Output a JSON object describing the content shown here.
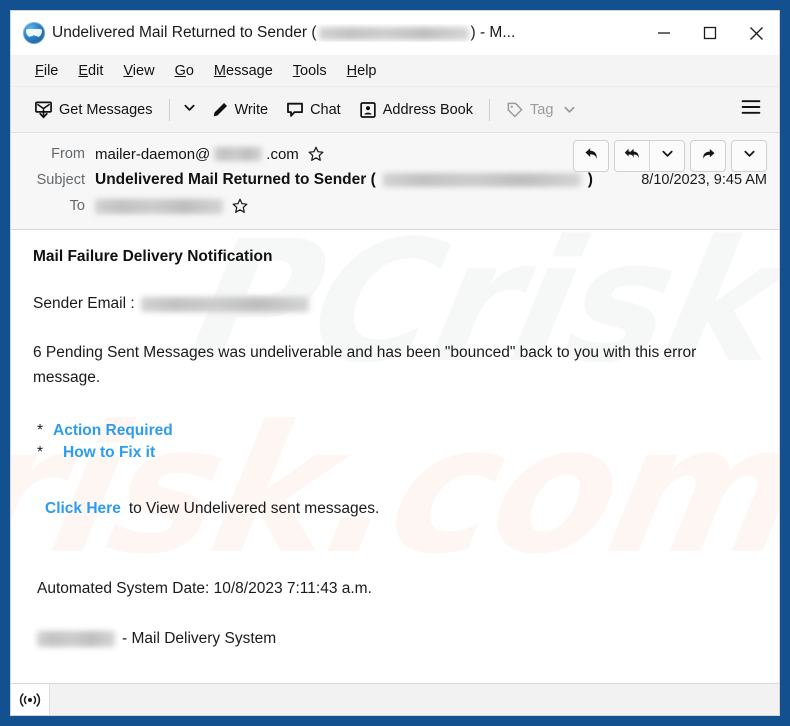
{
  "window": {
    "title_prefix": "Undelivered Mail Returned to Sender (",
    "title_suffix": ") - M...",
    "app_icon": "thunderbird-icon",
    "controls": {
      "minimize": "minimize-icon",
      "maximize": "maximize-icon",
      "close": "close-icon"
    },
    "frame_color": "#12508f"
  },
  "menu": {
    "items": [
      {
        "label": "File",
        "accesskey": "F"
      },
      {
        "label": "Edit",
        "accesskey": "E"
      },
      {
        "label": "View",
        "accesskey": "V"
      },
      {
        "label": "Go",
        "accesskey": "G"
      },
      {
        "label": "Message",
        "accesskey": "M"
      },
      {
        "label": "Tools",
        "accesskey": "T"
      },
      {
        "label": "Help",
        "accesskey": "H"
      }
    ]
  },
  "toolbar": {
    "get_messages_label": "Get Messages",
    "get_messages_icon": "download-mail-icon",
    "get_messages_caret": "chevron-down-icon",
    "write_label": "Write",
    "write_icon": "pencil-icon",
    "chat_label": "Chat",
    "chat_icon": "speech-bubble-icon",
    "address_book_label": "Address Book",
    "address_book_icon": "contact-card-icon",
    "tag_label": "Tag",
    "tag_icon": "tag-icon",
    "tag_caret": "chevron-down-icon",
    "app_menu_icon": "hamburger-menu-icon",
    "tag_disabled": true
  },
  "message_header": {
    "from_label": "From",
    "from_value_before": "mailer-daemon@",
    "from_value_after": ".com",
    "from_redacted": true,
    "from_star_icon": "star-outline-icon",
    "subject_label": "Subject",
    "subject_value_before": "Undelivered Mail Returned to Sender (",
    "subject_value_after": ")",
    "subject_redacted": true,
    "date": "8/10/2023, 9:45 AM",
    "to_label": "To",
    "to_redacted": true,
    "to_star_icon": "star-outline-icon",
    "actions": [
      {
        "name": "reply-button",
        "icon": "reply-arrow-icon"
      },
      {
        "name": "reply-all-button",
        "icon": "reply-all-arrow-icon"
      },
      {
        "name": "reply-all-dropdown",
        "icon": "chevron-down-icon"
      },
      {
        "name": "forward-button",
        "icon": "forward-arrow-icon"
      },
      {
        "name": "more-actions-dropdown",
        "icon": "chevron-down-icon"
      }
    ]
  },
  "body": {
    "heading": "Mail Failure Delivery Notification",
    "sender_email_label": "Sender Email :",
    "sender_email_redacted": true,
    "paragraph": "6  Pending Sent Messages was undeliverable and has been \"bounced\" back to you with this error message.",
    "bullets": [
      {
        "marker": "*",
        "link_text": "Action Required"
      },
      {
        "marker": "*",
        "link_text": "How to Fix it"
      }
    ],
    "cta_link": "Click Here",
    "cta_rest": "to View Undelivered sent messages.",
    "automated_date": "Automated System Date: 10/8/2023 7:11:43 a.m.",
    "signature_redacted": true,
    "signature_text": "- Mail Delivery System",
    "watermark_top": "PCrisk",
    "watermark_bottom": "risk.com",
    "link_color": "#2c9cf0"
  },
  "status_bar": {
    "indicator_icon": "connection-online-icon"
  }
}
